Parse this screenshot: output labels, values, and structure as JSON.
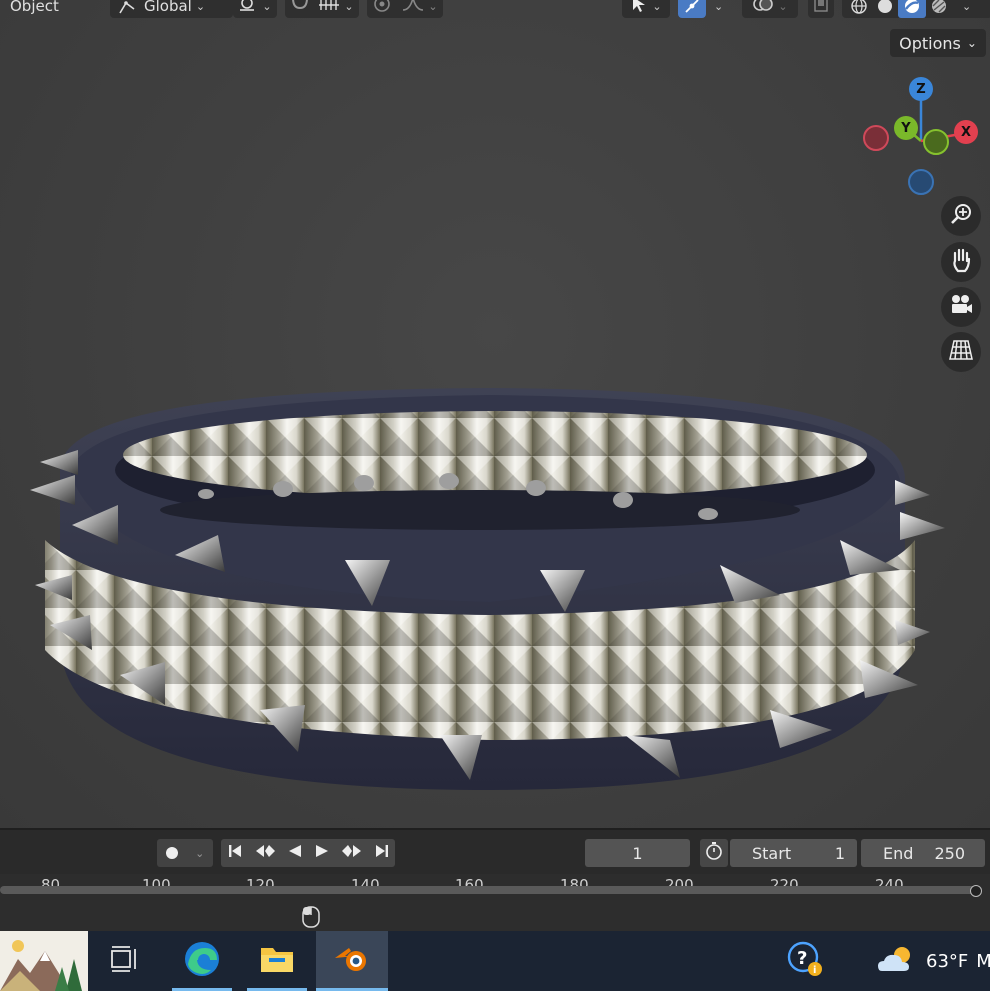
{
  "header": {
    "mode_label": "Object",
    "orientation_label": "Global",
    "options_label": "Options"
  },
  "gizmo": {
    "z_label": "Z",
    "y_label": "Y",
    "x_label": "X"
  },
  "colors": {
    "x_axis": "#e2404f",
    "y_axis": "#7ab82a",
    "z_axis": "#3a86d9",
    "timeline_accent": "#76b9ed"
  },
  "timeline": {
    "current_frame": "1",
    "start_label": "Start",
    "start_value": "1",
    "end_label": "End",
    "end_value": "250",
    "ruler_ticks": [
      "80",
      "100",
      "120",
      "140",
      "160",
      "180",
      "200",
      "220",
      "240"
    ]
  },
  "taskbar": {
    "weather_temp": "63°F",
    "weather_trailing": "M",
    "icons": [
      "task-view-icon",
      "edge-icon",
      "file-explorer-icon",
      "blender-icon",
      "help-icon",
      "cloudy-weather-icon"
    ]
  }
}
